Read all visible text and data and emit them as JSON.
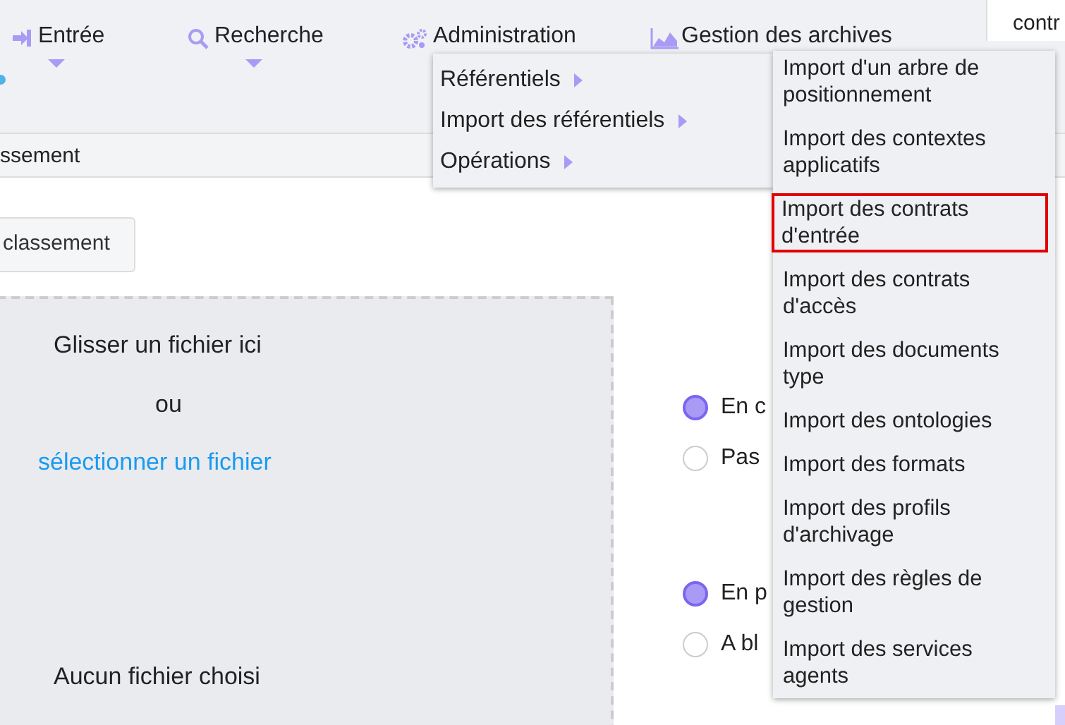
{
  "nav": {
    "items": [
      {
        "label": "Entrée",
        "caret": true
      },
      {
        "label": "Recherche",
        "caret": true
      },
      {
        "label": "Administration",
        "caret": false
      },
      {
        "label": "Gestion des archives",
        "caret": false
      }
    ],
    "tab": "contr"
  },
  "breadcrumb": "ssement",
  "action_button": "classement",
  "dropzone": {
    "title": "Glisser un fichier ici",
    "or": "ou",
    "link": "sélectionner un fichier",
    "file": "Aucun fichier choisi"
  },
  "radios": [
    {
      "label": "En c",
      "selected": true
    },
    {
      "label": "Pas",
      "selected": false
    },
    {
      "label": "En p",
      "selected": true
    },
    {
      "label": "A bl",
      "selected": false
    }
  ],
  "admin_menu": [
    {
      "label": "Référentiels",
      "submenu": true
    },
    {
      "label": "Import des référentiels",
      "submenu": true
    },
    {
      "label": "Opérations",
      "submenu": true
    }
  ],
  "import_menu": [
    {
      "label": "Import d'un arbre de positionnement",
      "highlighted": false
    },
    {
      "label": "Import des contextes applicatifs",
      "highlighted": false
    },
    {
      "label": "Import des contrats d'entrée",
      "highlighted": true
    },
    {
      "label": "Import des contrats d'accès",
      "highlighted": false
    },
    {
      "label": "Import des documents type",
      "highlighted": false
    },
    {
      "label": "Import des ontologies",
      "highlighted": false
    },
    {
      "label": "Import des formats",
      "highlighted": false
    },
    {
      "label": "Import des profils d'archivage",
      "highlighted": false
    },
    {
      "label": "Import des règles de gestion",
      "highlighted": false
    },
    {
      "label": "Import des services agents",
      "highlighted": false
    }
  ]
}
